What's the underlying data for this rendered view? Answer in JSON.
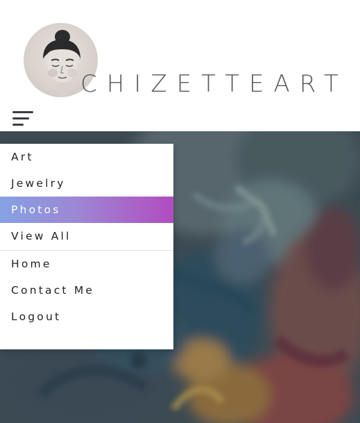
{
  "header": {
    "brand": "CHIZETTEART",
    "avatar_icon": "portrait-sketch",
    "menu_icon": "hamburger-menu-icon"
  },
  "menu": {
    "primary_items": [
      {
        "label": "Art"
      },
      {
        "label": "Jewelry"
      },
      {
        "label": "Photos",
        "active": true
      },
      {
        "label": "View All"
      }
    ],
    "secondary_items": [
      {
        "label": "Home"
      },
      {
        "label": "Contact Me"
      },
      {
        "label": "Logout"
      }
    ]
  },
  "colors": {
    "text": "#222326",
    "brand_text": "#56585b",
    "active_gradient_start": "#86a2e3",
    "active_gradient_end": "#b14cbf"
  }
}
